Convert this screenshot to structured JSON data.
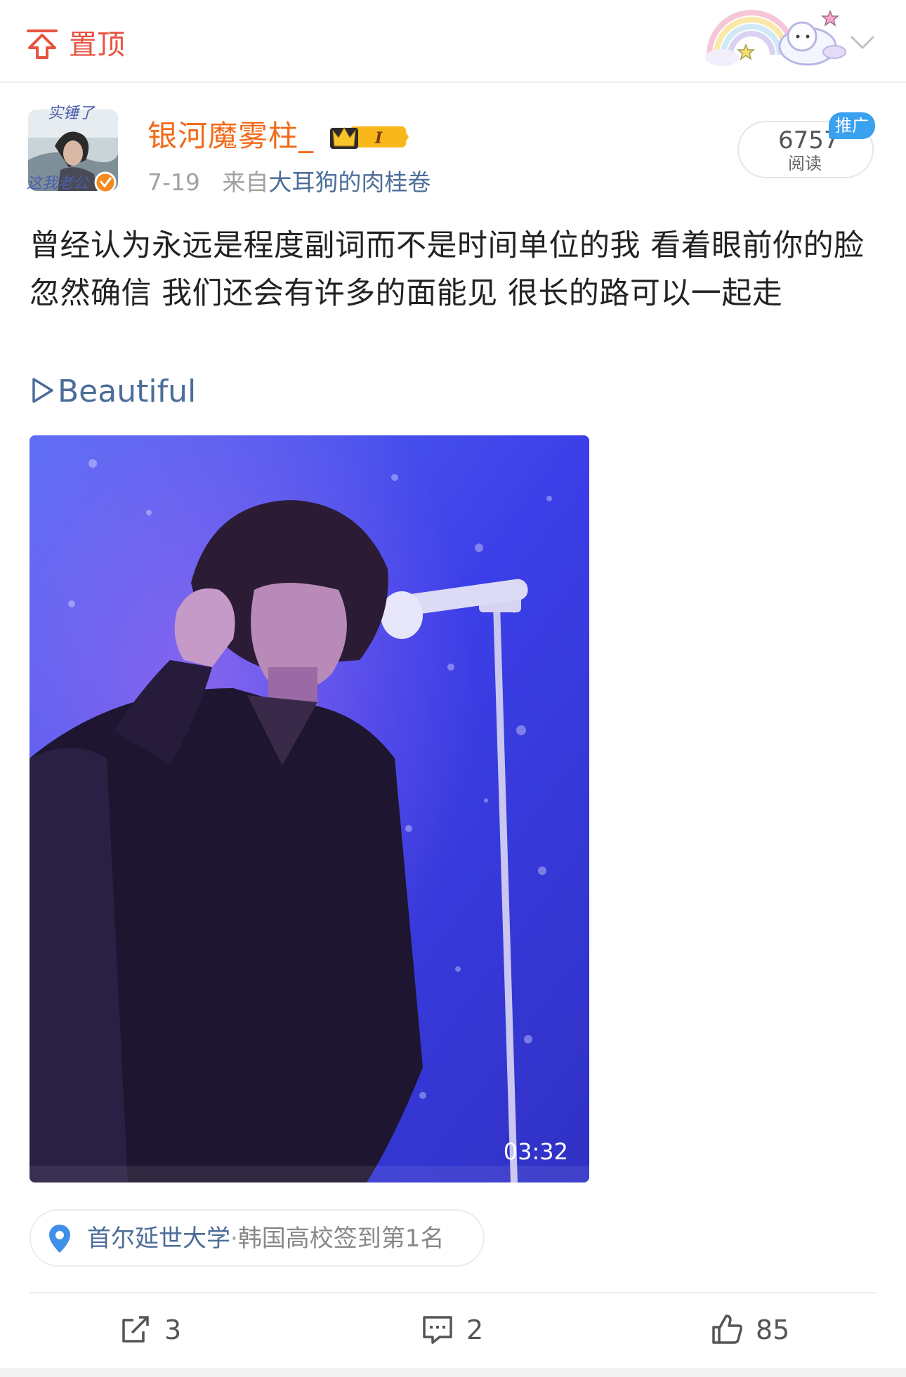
{
  "header": {
    "pin_label": "置顶",
    "icons": [
      "pin-up-arrow-icon",
      "rainbow-sticker",
      "chevron-down-icon"
    ]
  },
  "post": {
    "author": {
      "name": "银河魔雾柱_",
      "avatar_caption_top": "实锤了",
      "avatar_caption_bottom": "这我老公",
      "member_badge": "I",
      "verified": true
    },
    "date": "7-19",
    "source_prefix": "来自",
    "source": "大耳狗的肉桂卷",
    "reads": {
      "count": "6757",
      "label": "阅读",
      "promo_tag": "推广"
    },
    "text": "曾经认为永远是程度副词而不是时间单位的我 看着眼前你的脸 忽然确信 我们还会有许多的面能见 很长的路可以一起走",
    "music_title": "Beautiful",
    "video": {
      "duration": "03:32"
    },
    "location": {
      "name": "首尔延世大学",
      "separator": "·",
      "rank": "韩国高校签到第1名"
    }
  },
  "actions": {
    "share_count": "3",
    "comment_count": "2",
    "like_count": "85"
  },
  "colors": {
    "accent_orange": "#f26a18",
    "pin_red": "#e8523f",
    "link_blue": "#4c6d99",
    "promo_blue": "#3aa0f0"
  }
}
